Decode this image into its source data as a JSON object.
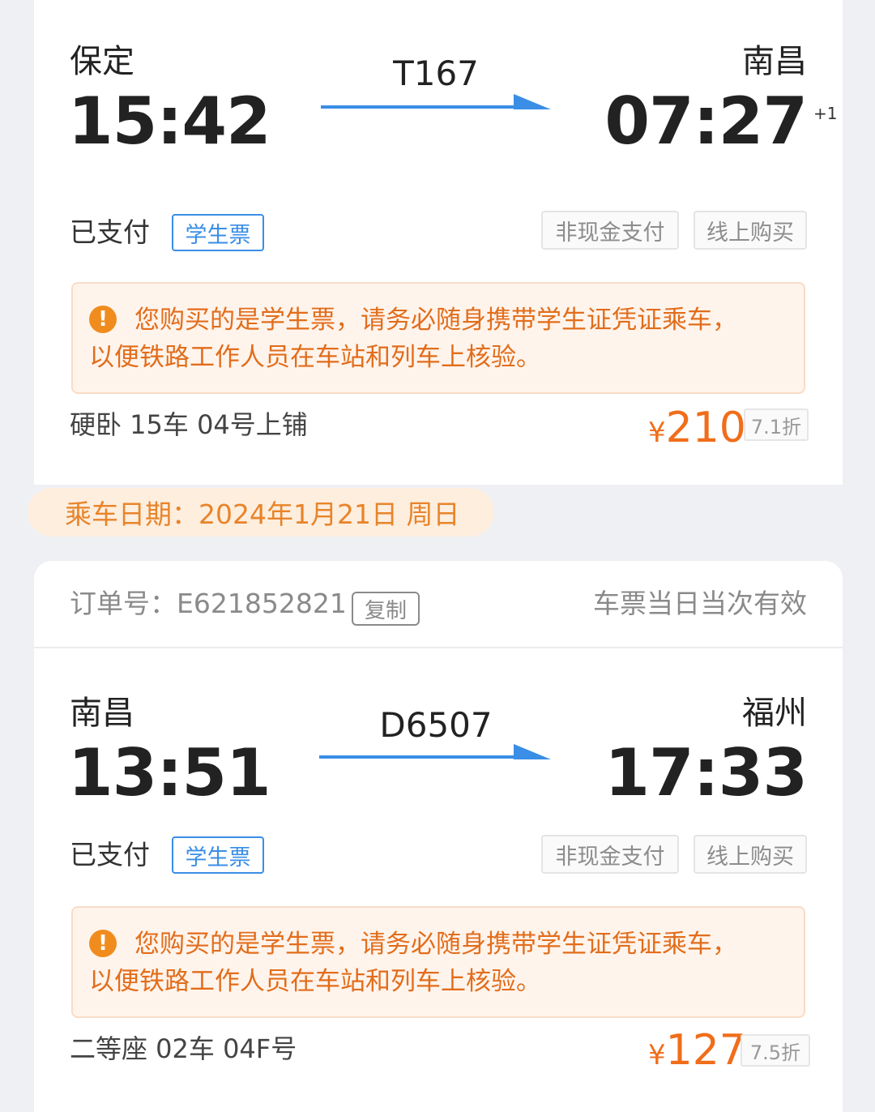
{
  "trip1": {
    "from_station": "保定",
    "departure_time": "15:42",
    "train_no": "T167",
    "to_station": "南昌",
    "arrival_time": "07:27",
    "day_offset": "+1",
    "status": "已支付",
    "ticket_type": "学生票",
    "tags": [
      "非现金支付",
      "线上购买"
    ],
    "notice": "您购买的是学生票，请务必随身携带学生证凭证乘车，以便铁路工作人员在车站和列车上核验。",
    "seat": "硬卧 15车 04号上铺",
    "currency": "¥",
    "price": "210",
    "discount": "7.1折"
  },
  "travel_date": "乘车日期：2024年1月21日 周日",
  "order": {
    "label": "订单号：E621852821",
    "copy_label": "复制",
    "validity": "车票当日当次有效"
  },
  "trip2": {
    "from_station": "南昌",
    "departure_time": "13:51",
    "train_no": "D6507",
    "to_station": "福州",
    "arrival_time": "17:33",
    "status": "已支付",
    "ticket_type": "学生票",
    "tags": [
      "非现金支付",
      "线上购买"
    ],
    "notice": "您购买的是学生票，请务必随身携带学生证凭证乘车，以便铁路工作人员在车站和列车上核验。",
    "seat": "二等座 02车 04F号",
    "currency": "¥",
    "price": "127",
    "discount": "7.5折"
  },
  "colors": {
    "accent_blue": "#3a8ee6",
    "price_orange": "#f06d1a",
    "notice_orange": "#e26d1b",
    "date_pill_bg": "#fdeede"
  },
  "icons": {
    "notice": "exclamation-circle-icon",
    "direction": "arrow-right-icon"
  }
}
